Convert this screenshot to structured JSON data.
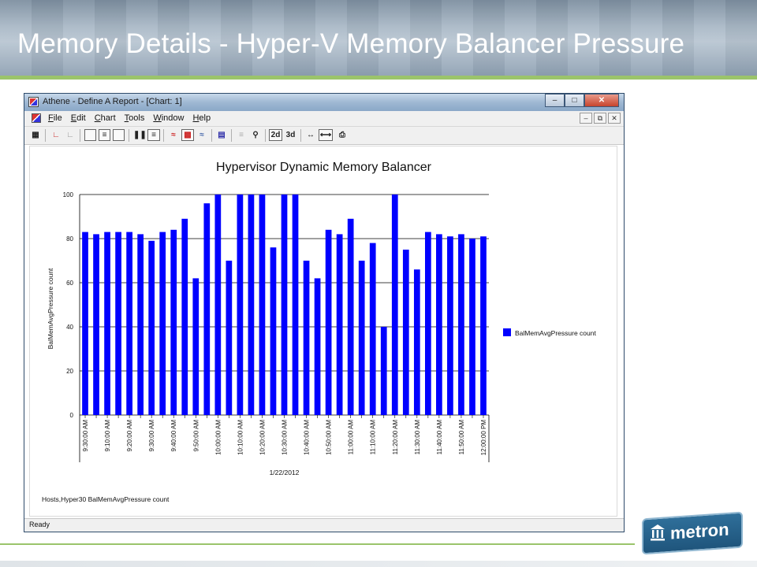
{
  "slide": {
    "title": "Memory Details - Hyper-V Memory Balancer Pressure",
    "logo_text": "metron",
    "colors": {
      "header_rule": "#9bc46b",
      "logo_blue": "#1f557c"
    }
  },
  "window": {
    "title": "Athene - Define A Report - [Chart: 1]",
    "controls": [
      "minimize",
      "maximize",
      "close"
    ],
    "menu": [
      {
        "label": "File",
        "accel": "F",
        "rest": "ile"
      },
      {
        "label": "Edit",
        "accel": "E",
        "rest": "dit"
      },
      {
        "label": "Chart",
        "accel": "C",
        "rest": "hart"
      },
      {
        "label": "Tools",
        "accel": "T",
        "rest": "ools"
      },
      {
        "label": "Window",
        "accel": "W",
        "rest": "indow"
      },
      {
        "label": "Help",
        "accel": "H",
        "rest": "elp"
      }
    ],
    "toolbar": {
      "btn_2d": "2d",
      "btn_3d": "3d"
    },
    "status": "Ready"
  },
  "chart_data": {
    "type": "bar",
    "title": "Hypervisor Dynamic Memory Balancer",
    "xlabel": "1/22/2012",
    "ylabel": "BalMemAvgPressure count",
    "ylim": [
      0,
      100
    ],
    "yticks": [
      0,
      20,
      40,
      60,
      80,
      100
    ],
    "grid": true,
    "legend_position": "right",
    "bar_color": "#0000ff",
    "footer": "Hosts,Hyper30 BalMemAvgPressure count",
    "tick_labels": [
      "9:30:00 AM",
      "9:10:00 AM",
      "9:20:00 AM",
      "9:30:00 AM",
      "9:40:00 AM",
      "9:50:00 AM",
      "10:00:00 AM",
      "10:10:00 AM",
      "10:20:00 AM",
      "10:30:00 AM",
      "10:40:00 AM",
      "10:50:00 AM",
      "11:00:00 AM",
      "11:10:00 AM",
      "11:20:00 AM",
      "11:30:00 AM",
      "11:40:00 AM",
      "11:50:00 AM",
      "12:00:00 PM"
    ],
    "series": [
      {
        "name": "BalMemAvgPressure count",
        "values": [
          83,
          82,
          83,
          83,
          83,
          82,
          79,
          83,
          84,
          89,
          62,
          96,
          100,
          70,
          100,
          100,
          100,
          76,
          100,
          100,
          70,
          62,
          84,
          82,
          89,
          70,
          78,
          40,
          100,
          75,
          66,
          83,
          82,
          81,
          82,
          80,
          81
        ]
      }
    ]
  }
}
